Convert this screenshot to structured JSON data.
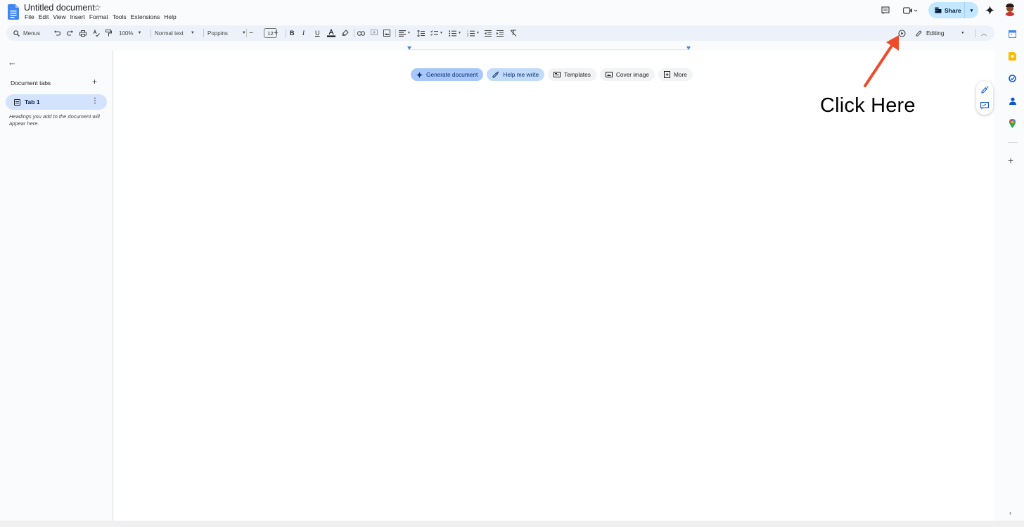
{
  "document": {
    "title": "Untitled document"
  },
  "menubar": {
    "items": [
      "File",
      "Edit",
      "View",
      "Insert",
      "Format",
      "Tools",
      "Extensions",
      "Help"
    ]
  },
  "header": {
    "share_label": "Share"
  },
  "toolbar": {
    "menus_label": "Menus",
    "zoom_value": "100%",
    "style_value": "Normal text",
    "font_value": "Poppins",
    "font_size_value": "12",
    "mode_value": "Editing"
  },
  "left_panel": {
    "section_title": "Document tabs",
    "tabs": [
      {
        "label": "Tab 1"
      }
    ],
    "hint": "Headings you add to the document will appear here."
  },
  "chips": [
    {
      "label": "Generate document",
      "icon": "sparkle-icon"
    },
    {
      "label": "Help me write",
      "icon": "pen-sparkle-icon"
    },
    {
      "label": "Templates",
      "icon": "template-icon"
    },
    {
      "label": "Cover image",
      "icon": "image-icon"
    },
    {
      "label": "More",
      "icon": "more-doc-icon"
    }
  ],
  "annotation": {
    "text": "Click Here",
    "arrow_color": "#ee4b2b"
  },
  "colors": {
    "share_bg": "#c2e7ff",
    "active_tab_bg": "#d3e3fd",
    "toolbar_bg": "#edf2fa",
    "docs_blue": "#4285f4"
  }
}
